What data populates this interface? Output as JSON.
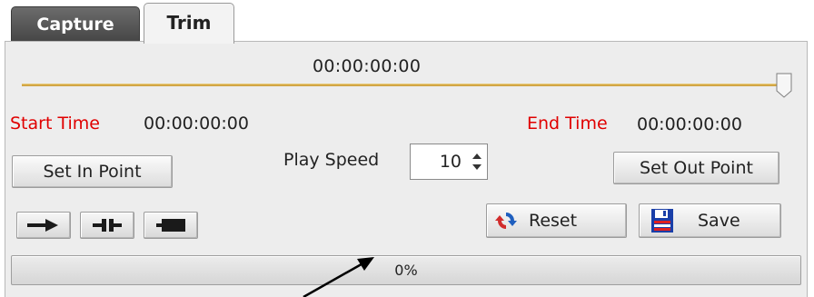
{
  "tabs": [
    {
      "label": "Capture"
    },
    {
      "label": "Trim"
    }
  ],
  "trim": {
    "current_time": "00:00:00:00",
    "start_label": "Start Time",
    "start_value": "00:00:00:00",
    "end_label": "End Time",
    "end_value": "00:00:00:00",
    "set_in_label": "Set In Point",
    "set_out_label": "Set Out Point",
    "play_speed_label": "Play Speed",
    "play_speed_value": "10",
    "reset_label": "Reset",
    "save_label": "Save",
    "progress_text": "0%",
    "progress_fraction": 0
  },
  "icons": {
    "play": "play-icon",
    "pause": "pause-icon",
    "stop": "stop-icon",
    "reset": "reset-icon",
    "save": "save-icon",
    "slider_thumb": "slider-thumb"
  },
  "colors": {
    "time_label": "#e00000",
    "slider_track": "#d2a646",
    "active_tab": "#f3f3f3",
    "inactive_tab": "#555555"
  }
}
